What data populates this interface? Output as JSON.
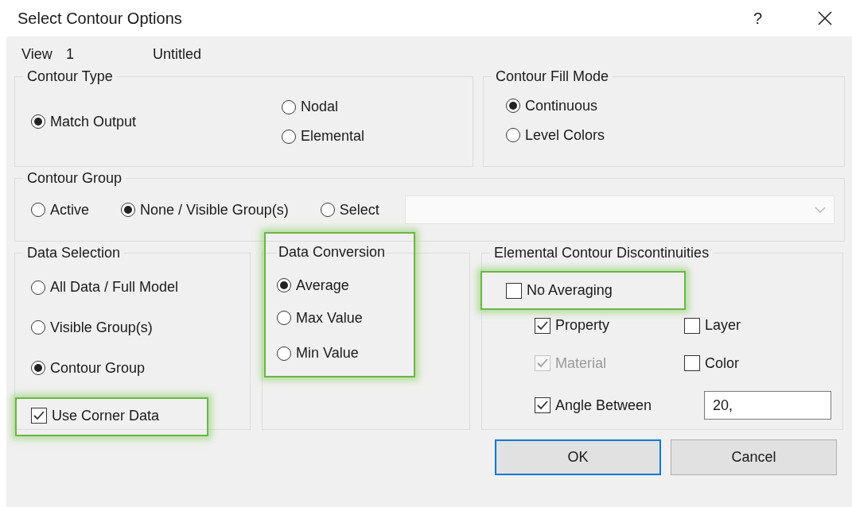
{
  "window": {
    "title": "Select Contour Options",
    "help": "?"
  },
  "view": {
    "label": "View",
    "number": "1",
    "name": "Untitled"
  },
  "contour_type": {
    "title": "Contour Type",
    "options": [
      {
        "label": "Match Output",
        "selected": true
      },
      {
        "label": "Nodal",
        "selected": false
      },
      {
        "label": "Elemental",
        "selected": false
      }
    ]
  },
  "contour_fill_mode": {
    "title": "Contour Fill Mode",
    "options": [
      {
        "label": "Continuous",
        "selected": true
      },
      {
        "label": "Level Colors",
        "selected": false
      }
    ]
  },
  "contour_group": {
    "title": "Contour Group",
    "options": [
      {
        "label": "Active",
        "selected": false
      },
      {
        "label": "None / Visible Group(s)",
        "selected": true
      },
      {
        "label": "Select",
        "selected": false
      }
    ],
    "dropdown": {
      "disabled": true
    }
  },
  "data_selection": {
    "title": "Data Selection",
    "options": [
      {
        "label": "All Data / Full Model",
        "selected": false
      },
      {
        "label": "Visible Group(s)",
        "selected": false
      },
      {
        "label": "Contour Group",
        "selected": true
      }
    ],
    "use_corner_data": {
      "label": "Use Corner Data",
      "checked": true,
      "disabled": false,
      "highlighted": true
    }
  },
  "data_conversion": {
    "title": "Data Conversion",
    "highlighted": true,
    "options": [
      {
        "label": "Average",
        "selected": true
      },
      {
        "label": "Max Value",
        "selected": false
      },
      {
        "label": "Min Value",
        "selected": false
      }
    ]
  },
  "elemental_discontinuities": {
    "title": "Elemental Contour Discontinuities",
    "no_averaging": {
      "label": "No Averaging",
      "checked": false,
      "disabled": false,
      "highlighted": true
    },
    "items": [
      {
        "label": "Property",
        "checked": true,
        "disabled": false
      },
      {
        "label": "Layer",
        "checked": false,
        "disabled": false
      },
      {
        "label": "Material",
        "checked": true,
        "disabled": true
      },
      {
        "label": "Color",
        "checked": false,
        "disabled": false
      }
    ],
    "angle_between": {
      "label": "Angle Between",
      "checked": true,
      "disabled": false,
      "value": "20,"
    }
  },
  "buttons": [
    {
      "label": "OK",
      "default": true
    },
    {
      "label": "Cancel",
      "default": false
    }
  ]
}
